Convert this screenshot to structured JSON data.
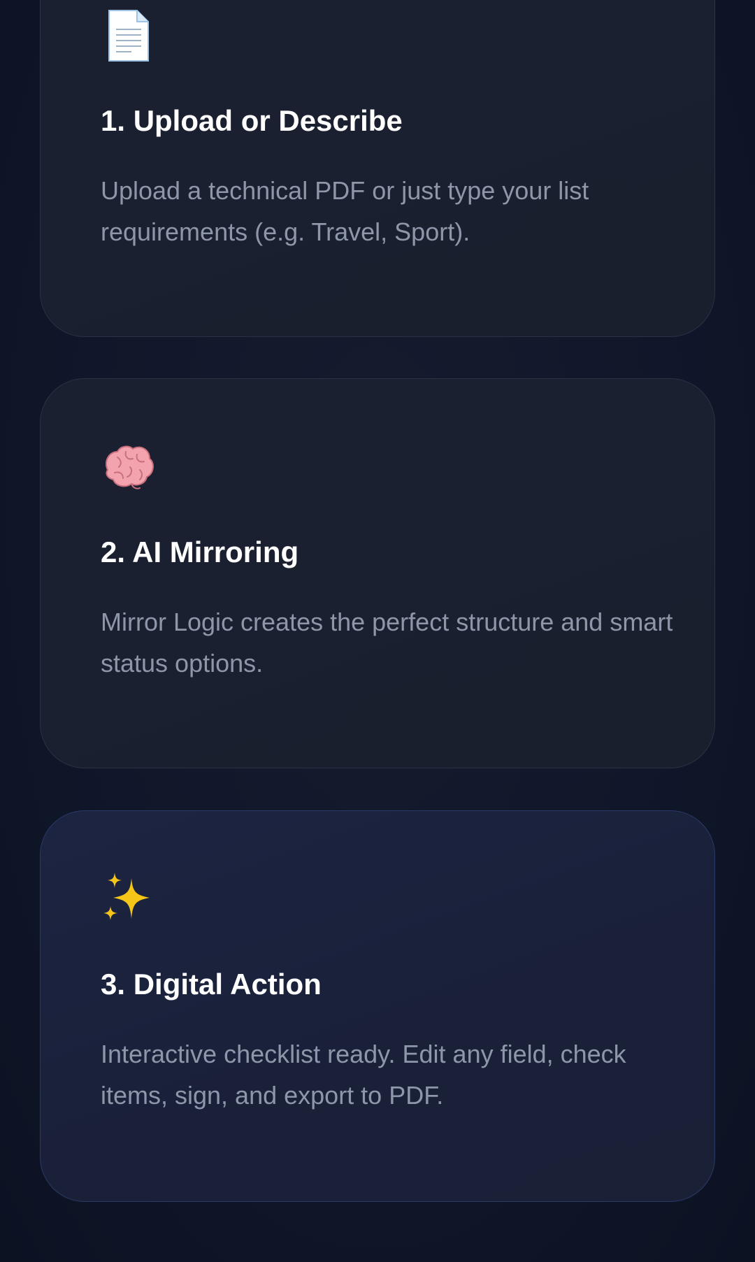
{
  "steps": [
    {
      "icon": "document-icon",
      "title": "1. Upload or Describe",
      "description": "Upload a technical PDF or just type your list requirements (e.g. Travel, Sport)."
    },
    {
      "icon": "brain-icon",
      "title": "2. AI Mirroring",
      "description": "Mirror Logic creates the perfect structure and smart status options."
    },
    {
      "icon": "sparkles-icon",
      "title": "3. Digital Action",
      "description": "Interactive checklist ready. Edit any field, check items, sign, and export to PDF."
    }
  ],
  "colors": {
    "background": "#10172a",
    "card": "#1a1f2e",
    "card_highlight": "#1c2442",
    "title": "#ffffff",
    "description": "#8e97a9",
    "sparkle": "#f5c518",
    "brain": "#f0a0a8"
  }
}
